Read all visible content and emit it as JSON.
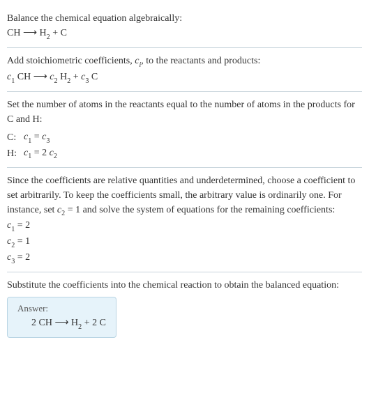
{
  "section1": {
    "heading": "Balance the chemical equation algebraically:",
    "equation_parts": {
      "lhs": "CH",
      "arrow": "⟶",
      "rhs_a": "H",
      "rhs_a_sub": "2",
      "plus": " + ",
      "rhs_b": "C"
    }
  },
  "section2": {
    "text_a": "Add stoichiometric coefficients, ",
    "ci": "c",
    "ci_sub": "i",
    "text_b": ", to the reactants and products:",
    "eq": {
      "c1": "c",
      "c1_sub": "1",
      "sp1": " CH ",
      "arrow": "⟶",
      "c2": " c",
      "c2_sub": "2",
      "sp2": " H",
      "h_sub": "2",
      "plus": " + ",
      "c3": "c",
      "c3_sub": "3",
      "sp3": " C"
    }
  },
  "section3": {
    "text": "Set the number of atoms in the reactants equal to the number of atoms in the products for C and H:",
    "rows": [
      {
        "label": "C:",
        "lhs_c": "c",
        "lhs_sub": "1",
        "eq": " = ",
        "rhs_c": "c",
        "rhs_sub": "3",
        "rhs_prefix": ""
      },
      {
        "label": "H:",
        "lhs_c": "c",
        "lhs_sub": "1",
        "eq": " = ",
        "rhs_prefix": "2 ",
        "rhs_c": "c",
        "rhs_sub": "2"
      }
    ]
  },
  "section4": {
    "text_a": "Since the coefficients are relative quantities and underdetermined, choose a coefficient to set arbitrarily. To keep the coefficients small, the arbitrary value is ordinarily one. For instance, set ",
    "cvar": "c",
    "cvar_sub": "2",
    "text_b": " = 1 and solve the system of equations for the remaining coefficients:",
    "solutions": [
      {
        "c": "c",
        "sub": "1",
        "val": " = 2"
      },
      {
        "c": "c",
        "sub": "2",
        "val": " = 1"
      },
      {
        "c": "c",
        "sub": "3",
        "val": " = 2"
      }
    ]
  },
  "section5": {
    "text": "Substitute the coefficients into the chemical reaction to obtain the balanced equation:",
    "answer_label": "Answer:",
    "answer": {
      "a": "2 CH ",
      "arrow": "⟶",
      "b": " H",
      "b_sub": "2",
      "c": " + 2 C"
    }
  },
  "chart_data": {
    "type": "table",
    "title": "Balancing CH → H2 + C",
    "unbalanced": "CH ⟶ H2 + C",
    "atom_equations": [
      {
        "element": "C",
        "equation": "c1 = c3"
      },
      {
        "element": "H",
        "equation": "c1 = 2 c2"
      }
    ],
    "coefficients": {
      "c1": 2,
      "c2": 1,
      "c3": 2
    },
    "balanced": "2 CH ⟶ H2 + 2 C"
  }
}
